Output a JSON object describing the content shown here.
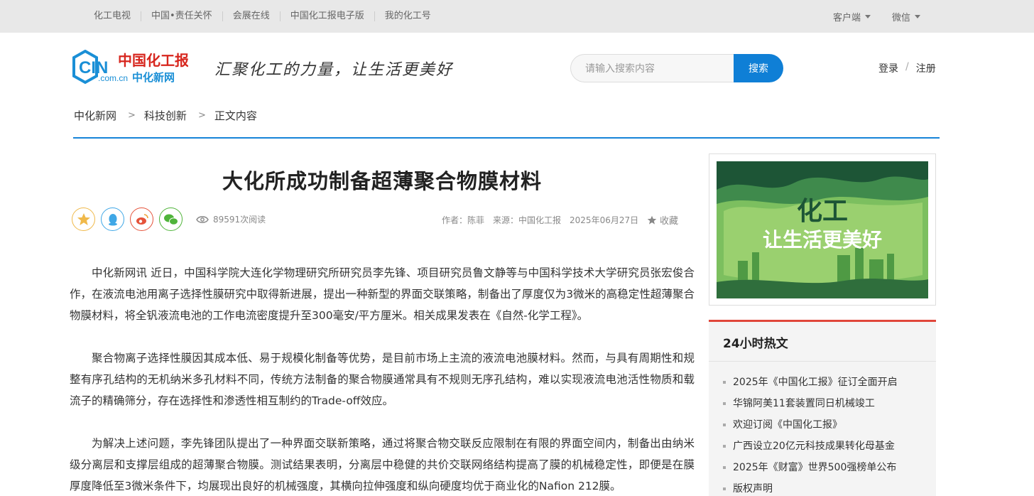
{
  "topbar": {
    "nav": [
      "化工电视",
      "中国•责任关怀",
      "会展在线",
      "中国化工报电子版",
      "我的化工号"
    ],
    "right": [
      "客户端",
      "微信"
    ]
  },
  "header": {
    "logo_cn": "中国化工报",
    "logo_sub": "中化新网",
    "logo_domain": ".com.cn",
    "logo_mark": "CIN",
    "slogan": "汇聚化工的力量，让生活更美好",
    "search_placeholder": "请输入搜索内容",
    "search_button": "搜索",
    "login": "登录",
    "sep": "/",
    "register": "注册"
  },
  "breadcrumb": [
    "中化新网",
    "科技创新",
    "正文内容"
  ],
  "article": {
    "title": "大化所成功制备超薄聚合物膜材料",
    "views": "89591次阅读",
    "author": "作者：陈菲",
    "source": "来源：中国化工报",
    "date": "2025年06月27日",
    "favorite": "收藏",
    "paragraphs": [
      "中化新网讯 近日，中国科学院大连化学物理研究所研究员李先锋、项目研究员鲁文静等与中国科学技术大学研究员张宏俊合作，在液流电池用离子选择性膜研究中取得新进展，提出一种新型的界面交联策略，制备出了厚度仅为3微米的高稳定性超薄聚合物膜材料，将全钒液流电池的工作电流密度提升至300毫安/平方厘米。相关成果发表在《自然-化学工程》。",
      "聚合物离子选择性膜因其成本低、易于规模化制备等优势，是目前市场上主流的液流电池膜材料。然而，与具有周期性和规整有序孔结构的无机纳米多孔材料不同，传统方法制备的聚合物膜通常具有不规则无序孔结构，难以实现液流电池活性物质和载流子的精确筛分，存在选择性和渗透性相互制约的Trade-off效应。",
      "为解决上述问题，李先锋团队提出了一种界面交联新策略，通过将聚合物交联反应限制在有限的界面空间内，制备出由纳米级分离层和支撑层组成的超薄聚合物膜。测试结果表明，分离层中稳健的共价交联网络结构提高了膜的机械稳定性，即便是在膜厚度降低至3微米条件下，均展现出良好的机械强度，其横向拉伸强度和纵向硬度均优于商业化的Nafion 212膜。"
    ]
  },
  "banner": {
    "line1": "化工",
    "line2": "让生活更美好"
  },
  "hot": {
    "title": "24小时热文",
    "items": [
      "2025年《中国化工报》征订全面开启",
      "华锦阿美11套装置同日机械竣工",
      "欢迎订阅《中国化工报》",
      "广西设立20亿元科技成果转化母基金",
      "2025年《财富》世界500强榜单公布",
      "版权声明"
    ]
  },
  "colors": {
    "accent_blue": "#0f7fd6",
    "divider_blue": "#1684d8",
    "hot_red": "#e0463a",
    "logo_red": "#d7261e",
    "logo_blue": "#1a8fd6"
  }
}
